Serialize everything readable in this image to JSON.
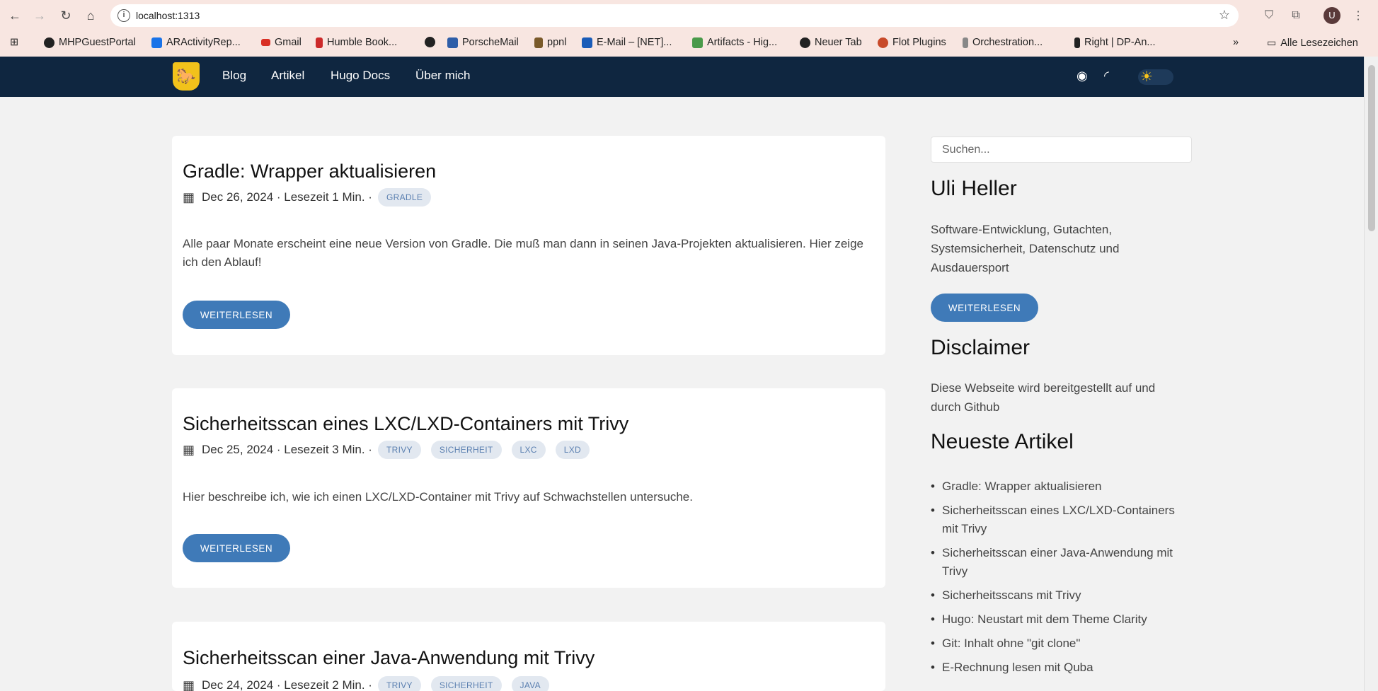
{
  "browser": {
    "url": "localhost:1313",
    "bookmarks": [
      {
        "label": "MHPGuestPortal",
        "color": "#222"
      },
      {
        "label": "ARActivityRep...",
        "color": "#1a73e8"
      },
      {
        "label": "Gmail",
        "color": "#d93025"
      },
      {
        "label": "Humble Book...",
        "color": "#cc2a2a"
      },
      {
        "label": "",
        "color": "#222"
      },
      {
        "label": "PorscheMail",
        "color": "#2f5ea8"
      },
      {
        "label": "ppnl",
        "color": "#7a5a2a"
      },
      {
        "label": "E-Mail – [NET]...",
        "color": "#1a5cb8"
      },
      {
        "label": "Artifacts - Hig...",
        "color": "#4a9a4a"
      },
      {
        "label": "Neuer Tab",
        "color": "#222"
      },
      {
        "label": "Flot Plugins",
        "color": "#c84a2a"
      },
      {
        "label": "Orchestration...",
        "color": "#666"
      },
      {
        "label": "Right | DP-An...",
        "color": "#222"
      }
    ],
    "all_bookmarks_label": "Alle Lesezeichen",
    "profile_initial": "U"
  },
  "site": {
    "nav": [
      "Blog",
      "Artikel",
      "Hugo Docs",
      "Über mich"
    ]
  },
  "posts": [
    {
      "title": "Gradle: Wrapper aktualisieren",
      "meta": "Dec 26, 2024 · Lesezeit 1 Min. ·",
      "tags": [
        "GRADLE"
      ],
      "excerpt": "Alle paar Monate erscheint eine neue Version von Gradle. Die muß man dann in seinen Java-Projekten aktualisieren. Hier zeige ich den Ablauf!",
      "button": "WEITERLESEN"
    },
    {
      "title": "Sicherheitsscan eines LXC/LXD-Containers mit Trivy",
      "meta": "Dec 25, 2024 · Lesezeit 3 Min. ·",
      "tags": [
        "TRIVY",
        "SICHERHEIT",
        "LXC",
        "LXD"
      ],
      "excerpt": "Hier beschreibe ich, wie ich einen LXC/LXD-Container mit Trivy auf Schwachstellen untersuche.",
      "button": "WEITERLESEN"
    },
    {
      "title": "Sicherheitsscan einer Java-Anwendung mit Trivy",
      "meta": "Dec 24, 2024 · Lesezeit 2 Min. ·",
      "tags": [
        "TRIVY",
        "SICHERHEIT",
        "JAVA"
      ]
    }
  ],
  "sidebar": {
    "search_placeholder": "Suchen...",
    "author": "Uli Heller",
    "author_desc": "Software-Entwicklung, Gutachten, Systemsicherheit, Datenschutz und Ausdauersport",
    "author_button": "WEITERLESEN",
    "disclaimer_title": "Disclaimer",
    "disclaimer_text": "Diese Webseite wird bereitgestellt auf und durch Github",
    "recent_title": "Neueste Artikel",
    "recent": [
      "Gradle: Wrapper aktualisieren",
      "Sicherheitsscan eines LXC/LXD-Containers mit Trivy",
      "Sicherheitsscan einer Java-Anwendung mit Trivy",
      "Sicherheitsscans mit Trivy",
      "Hugo: Neustart mit dem Theme Clarity",
      "Git: Inhalt ohne \"git clone\"",
      "E-Rechnung lesen mit Quba"
    ]
  }
}
